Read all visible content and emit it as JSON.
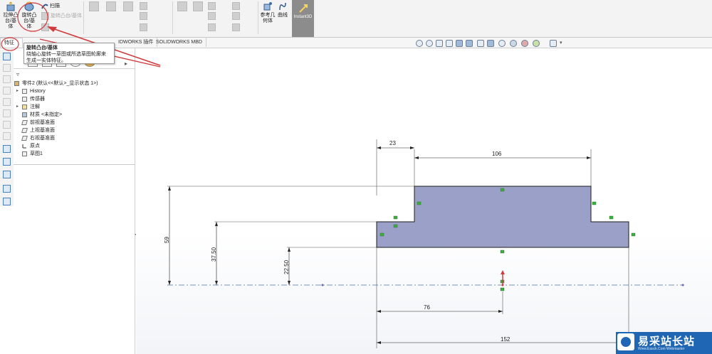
{
  "ribbon": {
    "extrude": {
      "label1": "拉伸凸",
      "label2": "台/基",
      "label3": "体"
    },
    "revolve": {
      "label1": "旋转凸",
      "label2": "台/基",
      "label3": "体"
    },
    "sweep_label": "扫描",
    "revolve_cut_label": "旋转凸台/基体",
    "ref_geometry": {
      "label1": "参考几",
      "label2": "何体"
    },
    "curves_label": "曲线",
    "instant3d_label": "Instant3D"
  },
  "tabs": {
    "feature": "特征",
    "plugins": "SOLIDWORKS 插件",
    "mbd": "SOLIDWORKS MBD",
    "clipped": "IDWORKS 插件"
  },
  "tooltip": {
    "title": "旋转凸台/基体",
    "line1": "绕轴心旋转一草图或所选草图轮廓来",
    "line2": "生成一实体特征。"
  },
  "tree": {
    "root": "零件2 (默认<<默认>_显示状态 1>)",
    "items": [
      "History",
      "传感器",
      "注解",
      "材质 <未指定>",
      "前视基准面",
      "上视基准面",
      "右视基准面",
      "原点",
      "草图1"
    ]
  },
  "colors": {
    "annotation_red": "#d23b3b",
    "fill": "#9ba0c8",
    "relation_green": "#3fae3f",
    "watermark_blue": "#1f66b5"
  },
  "drawing": {
    "dimensions": [
      "23",
      "106",
      "59",
      "37.50",
      "22.50",
      "76",
      "152"
    ]
  },
  "watermark": {
    "text": "易采站长站",
    "sub": "Www.Easck.Com Webmaster"
  }
}
